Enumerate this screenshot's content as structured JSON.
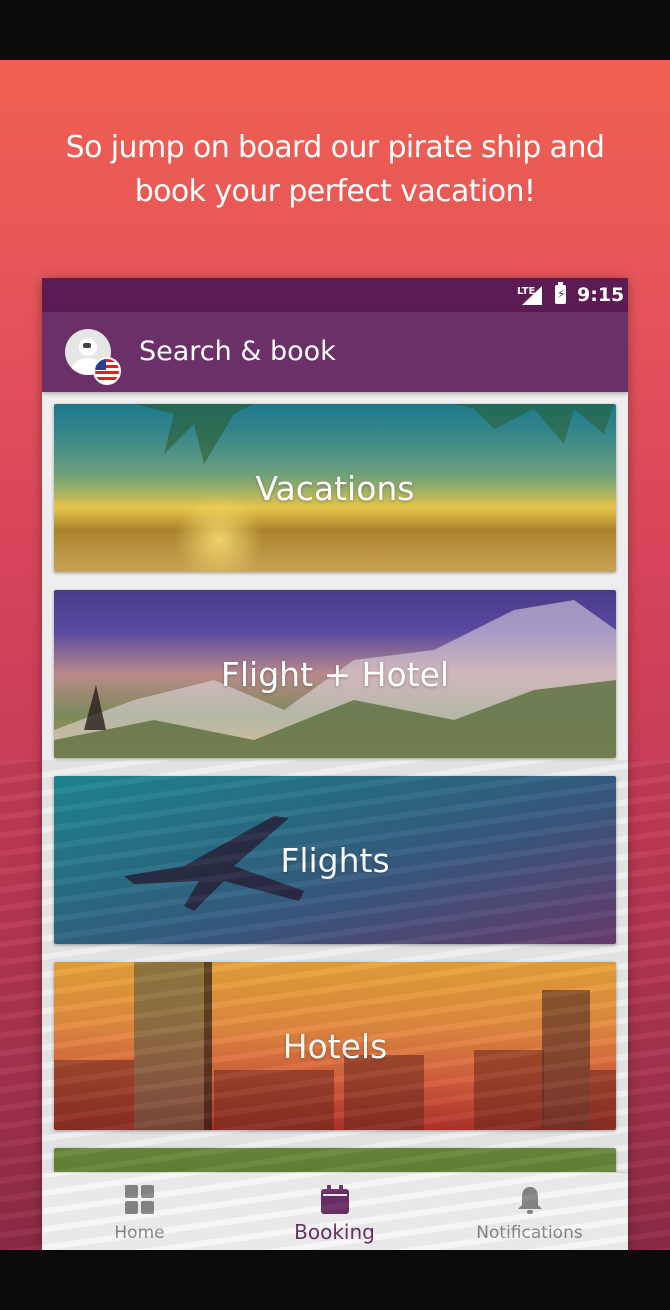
{
  "tagline": "So jump on board our pirate ship and book your perfect vacation!",
  "status_bar": {
    "network": "LTE",
    "time": "9:15"
  },
  "app_bar": {
    "title": "Search & book"
  },
  "cards": [
    {
      "label": "Vacations"
    },
    {
      "label": "Flight + Hotel"
    },
    {
      "label": "Flights"
    },
    {
      "label": "Hotels"
    }
  ],
  "bottom_nav": {
    "items": [
      {
        "label": "Home",
        "icon": "grid-icon",
        "active": false
      },
      {
        "label": "Booking",
        "icon": "calendar-icon",
        "active": true
      },
      {
        "label": "Notifications",
        "icon": "bell-icon",
        "active": false
      }
    ]
  },
  "colors": {
    "accent": "#6b3068",
    "status_bar": "#5c1b52",
    "hero_top": "#f0604f",
    "hero_bottom": "#8f2b47"
  }
}
